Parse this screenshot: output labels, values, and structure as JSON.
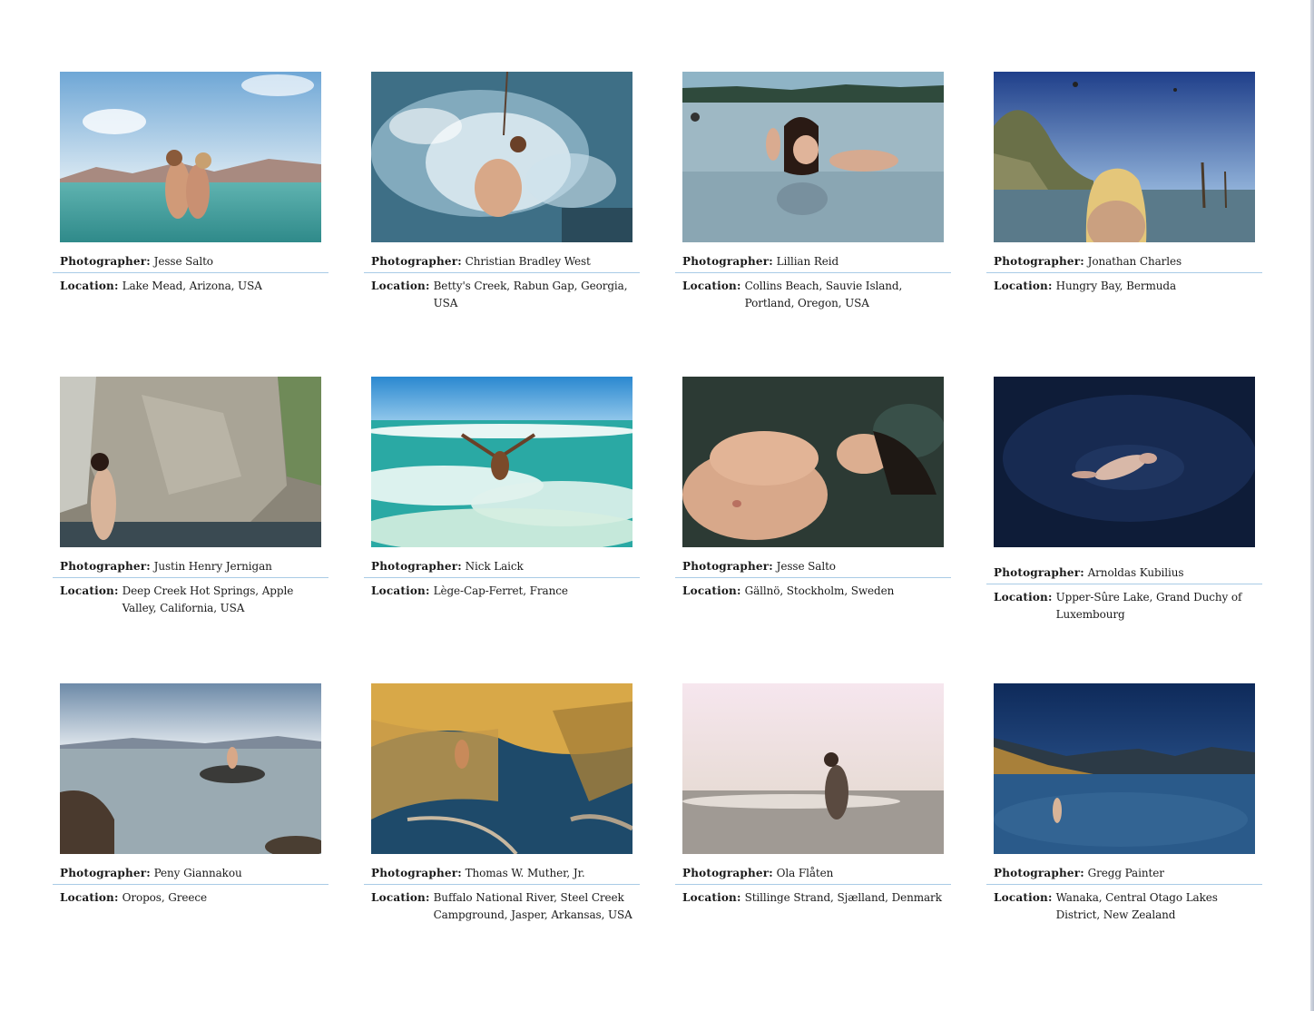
{
  "labels": {
    "photographer": "Photographer:",
    "location": "Location:"
  },
  "cards": [
    {
      "photographer": "Jesse Salto",
      "location": "Lake Mead, Arizona, USA",
      "image": "couple-kissing-in-lake-photo"
    },
    {
      "photographer": "Christian Bradley West",
      "location": "Betty's Creek, Rabun Gap, Georgia, USA",
      "image": "rope-swing-splash-photo"
    },
    {
      "photographer": "Lillian Reid",
      "location": "Collins Beach, Sauvie Island, Portland, Oregon, USA",
      "image": "woman-in-river-photo"
    },
    {
      "photographer": "Jonathan Charles",
      "location": "Hungry Bay, Bermuda",
      "image": "blonde-woman-mangroves-photo"
    },
    {
      "photographer": "Justin Henry Jernigan",
      "location": "Deep Creek Hot Springs, Apple Valley, California, USA",
      "image": "woman-by-rock-waterfall-photo"
    },
    {
      "photographer": "Nick Laick",
      "location": "Lège-Cap-Ferret, France",
      "image": "man-in-ocean-waves-photo"
    },
    {
      "photographer": "Jesse Salto",
      "location": "Gällnö, Stockholm, Sweden",
      "image": "woman-floating-photo"
    },
    {
      "photographer": "Arnoldas Kubilius",
      "location": "Upper-Sûre Lake, Grand Duchy of Luxembourg",
      "image": "swimmer-dark-water-photo"
    },
    {
      "photographer": "Peny Giannakou",
      "location": "Oropos, Greece",
      "image": "person-on-rock-sea-photo"
    },
    {
      "photographer": "Thomas W. Muther, Jr.",
      "location": "Buffalo National River, Steel Creek Campground, Jasper, Arkansas, USA",
      "image": "man-in-golden-reflection-photo"
    },
    {
      "photographer": "Ola Flåten",
      "location": "Stillinge Strand, Sjælland, Denmark",
      "image": "man-in-sea-backlit-photo"
    },
    {
      "photographer": "Gregg Painter",
      "location": "Wanaka, Central Otago Lakes District, New Zealand",
      "image": "lake-mountains-blue-photo"
    }
  ]
}
